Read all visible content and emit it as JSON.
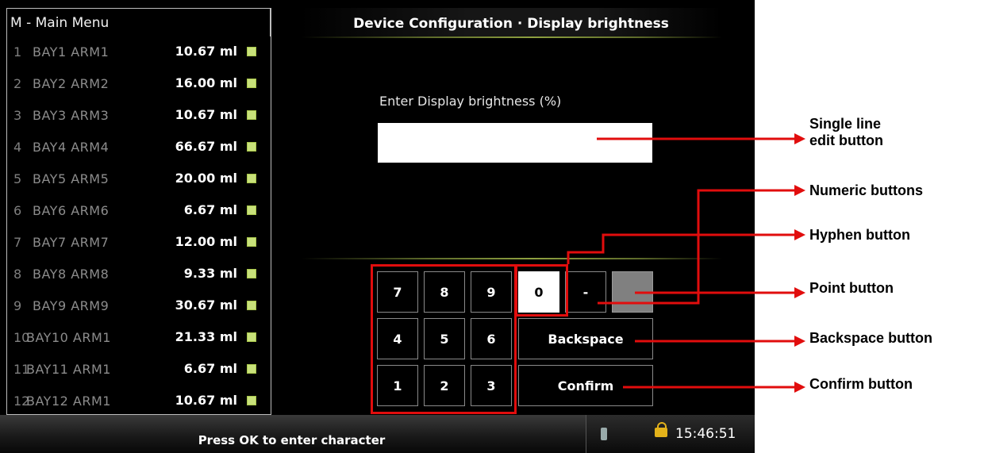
{
  "menu": {
    "title": "M - Main Menu",
    "items": [
      {
        "num": "1",
        "name": "BAY1 ARM1",
        "value": "10.67 ml"
      },
      {
        "num": "2",
        "name": "BAY2 ARM2",
        "value": "16.00 ml"
      },
      {
        "num": "3",
        "name": "BAY3 ARM3",
        "value": "10.67 ml"
      },
      {
        "num": "4",
        "name": "BAY4 ARM4",
        "value": "66.67 ml"
      },
      {
        "num": "5",
        "name": "BAY5 ARM5",
        "value": "20.00 ml"
      },
      {
        "num": "6",
        "name": "BAY6 ARM6",
        "value": "6.67 ml"
      },
      {
        "num": "7",
        "name": "BAY7 ARM7",
        "value": "12.00 ml"
      },
      {
        "num": "8",
        "name": "BAY8 ARM8",
        "value": "9.33 ml"
      },
      {
        "num": "9",
        "name": "BAY9 ARM9",
        "value": "30.67 ml"
      },
      {
        "num": "10",
        "name": "BAY10 ARM1",
        "value": "21.33 ml"
      },
      {
        "num": "11",
        "name": "BAY11 ARM1",
        "value": "6.67 ml"
      },
      {
        "num": "12",
        "name": "BAY12 ARM1",
        "value": "10.67 ml"
      }
    ]
  },
  "header": {
    "title": "Device Configuration · Display brightness"
  },
  "form": {
    "prompt": "Enter Display brightness (%)",
    "value": ""
  },
  "keypad": {
    "row1": [
      "7",
      "8",
      "9",
      "0",
      "-",
      ""
    ],
    "row2": [
      "4",
      "5",
      "6"
    ],
    "row3": [
      "1",
      "2",
      "3"
    ],
    "backspace": "Backspace",
    "confirm": "Confirm"
  },
  "status": {
    "message": "Press OK to enter character",
    "time": "15:46:51"
  },
  "annotations": {
    "single_line_1": "Single line",
    "single_line_2": "edit button",
    "numeric": "Numeric buttons",
    "hyphen": "Hyphen button",
    "point": "Point button",
    "backspace": "Backspace button",
    "confirm": "Confirm button"
  },
  "colors": {
    "annotation": "#e10d0d",
    "indicator": "#c8e17a",
    "selected_key": "#ffffff"
  },
  "icons": [
    "usb-icon",
    "unlock-icon",
    "arrow-right-icon"
  ]
}
